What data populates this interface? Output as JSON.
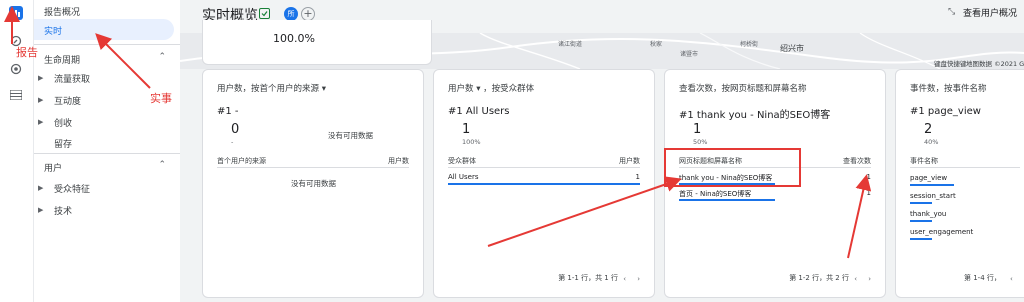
{
  "nav": {
    "report_overview": "报告概况",
    "realtime": "实时",
    "lifecycle": "生命周期",
    "acquisition": "流量获取",
    "engagement": "互动度",
    "monetization": "创收",
    "retention": "留存",
    "user": "用户",
    "demographics": "受众特征",
    "tech": "技术"
  },
  "header": {
    "title": "实时概览",
    "view_user_overview": "查看用户概况",
    "avatar_letter": "所"
  },
  "top_stat": {
    "value": "100.0%"
  },
  "map": {
    "city": "绍兴市",
    "shortcut": "键盘快捷键",
    "attribution": "地图数据 ©2021 G",
    "labels": [
      "诸江街道",
      "秋家",
      "诸暨市",
      "柯桥街"
    ]
  },
  "cards": [
    {
      "title": "用户数，按首个用户的来源",
      "top_label": "#1  -",
      "top_value": "0",
      "top_pct": "-",
      "col1": "首个用户的来源",
      "col2": "用户数",
      "no_data": "没有可用数据",
      "no_data_top": "没有可用数据",
      "rows": []
    },
    {
      "title": "用户数 ▾ ，按受众群体",
      "top_label": "#1  All Users",
      "top_value": "1",
      "top_pct": "100%",
      "col1": "受众群体",
      "col2": "用户数",
      "rows": [
        {
          "label": "All Users",
          "value": "1",
          "share": 1.0
        }
      ],
      "footer": "第 1-1 行，共 1 行"
    },
    {
      "title": "查看次数，按网页标题和屏幕名称",
      "top_label": "#1  thank you - Nina的SEO博客",
      "top_value": "1",
      "top_pct": "50%",
      "col1": "网页标题和屏幕名称",
      "col2": "查看次数",
      "rows": [
        {
          "label": "thank you - Nina的SEO博客",
          "value": "1",
          "share": 0.5
        },
        {
          "label": "首页 - Nina的SEO博客",
          "value": "1",
          "share": 0.5
        }
      ],
      "footer": "第 1-2 行，共 2 行"
    },
    {
      "title": "事件数，按事件名称",
      "top_label": "#1  page_view",
      "top_value": "2",
      "top_pct": "40%",
      "col1": "事件名称",
      "rows": [
        {
          "label": "page_view",
          "value": "",
          "share": 0.4
        },
        {
          "label": "session_start",
          "value": "",
          "share": 0.2
        },
        {
          "label": "thank_you",
          "value": "",
          "share": 0.2
        },
        {
          "label": "user_engagement",
          "value": "",
          "share": 0.2
        }
      ],
      "footer": "第 1-4 行，"
    }
  ],
  "annotations": {
    "report": "报告",
    "realtime": "实事"
  },
  "colors": {
    "accent": "#1a73e8",
    "annotation": "#e53935",
    "active_bg": "#e8f0fe"
  }
}
